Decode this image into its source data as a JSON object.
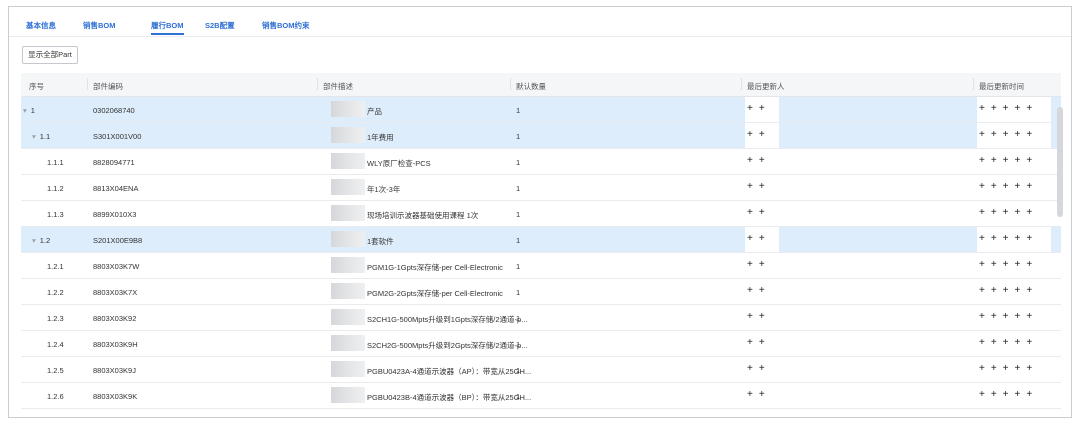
{
  "tabs": [
    {
      "label": "基本信息",
      "active": false
    },
    {
      "label": "销售BOM",
      "active": false
    },
    {
      "label": "履行BOM",
      "active": true
    },
    {
      "label": "S2B配置",
      "active": false
    },
    {
      "label": "销售BOM约束",
      "active": false
    }
  ],
  "toolbar": {
    "show_all_label": "显示全部Part"
  },
  "columns": {
    "seq": "序号",
    "code": "部件编码",
    "desc": "部件描述",
    "qty": "默认数量",
    "updater": "最后更新人",
    "time": "最后更新时间"
  },
  "rows": [
    {
      "seq": "1",
      "code": "0302068740",
      "desc": "产品",
      "qty": "1",
      "expandable": true,
      "highlight": true
    },
    {
      "seq": "1.1",
      "code": "S301X001V00",
      "desc": "1年费用",
      "qty": "1",
      "expandable": true,
      "highlight": true
    },
    {
      "seq": "1.1.1",
      "code": "8828094771",
      "desc": "WLY原厂检查-PCS",
      "qty": "1",
      "expandable": false,
      "highlight": false
    },
    {
      "seq": "1.1.2",
      "code": "8813X04ENA",
      "desc": "年1次-3年",
      "qty": "1",
      "expandable": false,
      "highlight": false
    },
    {
      "seq": "1.1.3",
      "code": "8899X010X3",
      "desc": "现场培训示波器基础使用课程 1次",
      "qty": "1",
      "expandable": false,
      "highlight": false
    },
    {
      "seq": "1.2",
      "code": "S201X00E9B8",
      "desc": "1套软件",
      "qty": "1",
      "expandable": true,
      "highlight": true
    },
    {
      "seq": "1.2.1",
      "code": "8803X03K7W",
      "desc": "PGM1G-1Gpts深存储-per Cell-Electronic",
      "qty": "1",
      "expandable": false,
      "highlight": false
    },
    {
      "seq": "1.2.2",
      "code": "8803X03K7X",
      "desc": "PGM2G-2Gpts深存储-per Cell-Electronic",
      "qty": "1",
      "expandable": false,
      "highlight": false
    },
    {
      "seq": "1.2.3",
      "code": "8803X03K92",
      "desc": "S2CH1G-500Mpts升级到1Gpts深存储/2通道-p...",
      "qty": "1",
      "expandable": false,
      "highlight": false
    },
    {
      "seq": "1.2.4",
      "code": "8803X03K9H",
      "desc": "S2CH2G-500Mpts升级到2Gpts深存储/2通道-p...",
      "qty": "1",
      "expandable": false,
      "highlight": false
    },
    {
      "seq": "1.2.5",
      "code": "8803X03K9J",
      "desc": "PGBU0423A-4通道示波器（AP）：带宽从25GH...",
      "qty": "1",
      "expandable": false,
      "highlight": false
    },
    {
      "seq": "1.2.6",
      "code": "8803X03K9K",
      "desc": "PGBU0423B-4通道示波器（BP）：带宽从25GH...",
      "qty": "1",
      "expandable": false,
      "highlight": false
    }
  ],
  "icons": {
    "expand": "caret-down-icon"
  },
  "colors": {
    "accent": "#2f6fd6",
    "row_highlight": "#deedfb"
  }
}
